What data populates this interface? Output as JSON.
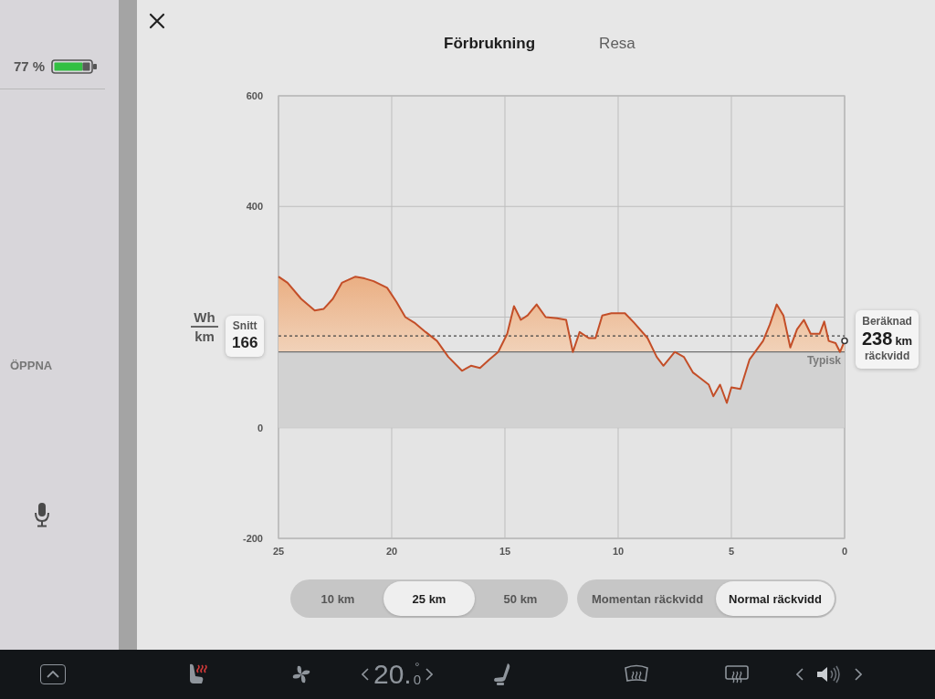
{
  "side_panel": {
    "battery_percent": "77 %",
    "trunk_button": "ÖPPNA"
  },
  "tabs": [
    {
      "label": "Förbrukning",
      "selected": true
    },
    {
      "label": "Resa",
      "selected": false
    }
  ],
  "chart": {
    "unit_top": "Wh",
    "unit_bottom": "km",
    "average": {
      "label": "Snitt",
      "value": "166"
    },
    "estimate": {
      "title": "Beräknad",
      "value": "238",
      "unit": "km",
      "caption": "räckvidd"
    },
    "chart_data": {
      "type": "area",
      "x": [
        25.0,
        24.6,
        24.0,
        23.4,
        23.0,
        22.6,
        22.2,
        21.6,
        21.2,
        20.8,
        20.2,
        19.8,
        19.4,
        19.0,
        18.5,
        18.0,
        17.5,
        16.9,
        16.5,
        16.1,
        15.7,
        15.3,
        14.9,
        14.6,
        14.3,
        14.0,
        13.6,
        13.2,
        12.7,
        12.3,
        12.0,
        11.7,
        11.3,
        11.0,
        10.7,
        10.3,
        9.7,
        9.3,
        8.7,
        8.3,
        8.0,
        7.5,
        7.1,
        6.7,
        6.0,
        5.8,
        5.5,
        5.2,
        5.0,
        4.6,
        4.2,
        3.6,
        3.3,
        3.0,
        2.7,
        2.4,
        2.1,
        1.8,
        1.5,
        1.1,
        0.9,
        0.7,
        0.4,
        0.2,
        0.0
      ],
      "values": [
        273,
        262,
        233,
        212,
        215,
        233,
        262,
        273,
        270,
        265,
        253,
        228,
        200,
        190,
        173,
        157,
        128,
        103,
        112,
        108,
        123,
        137,
        170,
        220,
        195,
        203,
        223,
        200,
        198,
        195,
        137,
        173,
        162,
        162,
        203,
        207,
        207,
        190,
        162,
        128,
        112,
        137,
        128,
        100,
        78,
        57,
        78,
        45,
        73,
        70,
        123,
        157,
        187,
        223,
        203,
        145,
        178,
        195,
        170,
        170,
        192,
        157,
        153,
        137,
        157
      ],
      "xlim": [
        25,
        0
      ],
      "ylim": [
        -200,
        600
      ],
      "xticks": [
        25,
        20,
        15,
        10,
        5,
        0
      ],
      "yticks": [
        -200,
        0,
        400,
        600
      ],
      "grid": true,
      "ref_lines": [
        {
          "axis": "y",
          "value": 166
        },
        {
          "axis": "y",
          "value": 137,
          "label": "Typisk"
        }
      ]
    }
  },
  "distance_options": [
    {
      "label": "10 km",
      "selected": false
    },
    {
      "label": "25 km",
      "selected": true
    },
    {
      "label": "50 km",
      "selected": false
    }
  ],
  "range_modes": [
    {
      "label": "Momentan räckvidd",
      "selected": false
    },
    {
      "label": "Normal räckvidd",
      "selected": true
    }
  ],
  "climate_bar": {
    "temperature": "20.",
    "temperature_decimal": "0",
    "degree": "°"
  }
}
